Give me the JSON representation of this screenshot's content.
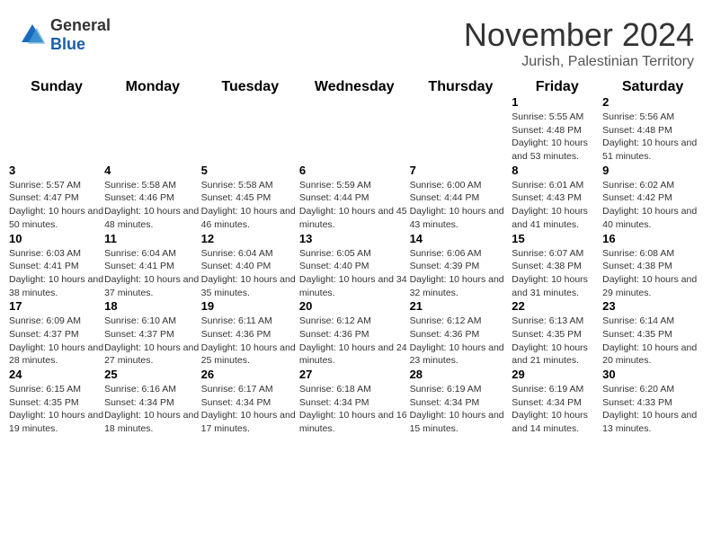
{
  "header": {
    "logo_general": "General",
    "logo_blue": "Blue",
    "month_title": "November 2024",
    "location": "Jurish, Palestinian Territory"
  },
  "days_of_week": [
    "Sunday",
    "Monday",
    "Tuesday",
    "Wednesday",
    "Thursday",
    "Friday",
    "Saturday"
  ],
  "weeks": [
    [
      {
        "day": "",
        "info": ""
      },
      {
        "day": "",
        "info": ""
      },
      {
        "day": "",
        "info": ""
      },
      {
        "day": "",
        "info": ""
      },
      {
        "day": "",
        "info": ""
      },
      {
        "day": "1",
        "info": "Sunrise: 5:55 AM\nSunset: 4:48 PM\nDaylight: 10 hours and 53 minutes."
      },
      {
        "day": "2",
        "info": "Sunrise: 5:56 AM\nSunset: 4:48 PM\nDaylight: 10 hours and 51 minutes."
      }
    ],
    [
      {
        "day": "3",
        "info": "Sunrise: 5:57 AM\nSunset: 4:47 PM\nDaylight: 10 hours and 50 minutes."
      },
      {
        "day": "4",
        "info": "Sunrise: 5:58 AM\nSunset: 4:46 PM\nDaylight: 10 hours and 48 minutes."
      },
      {
        "day": "5",
        "info": "Sunrise: 5:58 AM\nSunset: 4:45 PM\nDaylight: 10 hours and 46 minutes."
      },
      {
        "day": "6",
        "info": "Sunrise: 5:59 AM\nSunset: 4:44 PM\nDaylight: 10 hours and 45 minutes."
      },
      {
        "day": "7",
        "info": "Sunrise: 6:00 AM\nSunset: 4:44 PM\nDaylight: 10 hours and 43 minutes."
      },
      {
        "day": "8",
        "info": "Sunrise: 6:01 AM\nSunset: 4:43 PM\nDaylight: 10 hours and 41 minutes."
      },
      {
        "day": "9",
        "info": "Sunrise: 6:02 AM\nSunset: 4:42 PM\nDaylight: 10 hours and 40 minutes."
      }
    ],
    [
      {
        "day": "10",
        "info": "Sunrise: 6:03 AM\nSunset: 4:41 PM\nDaylight: 10 hours and 38 minutes."
      },
      {
        "day": "11",
        "info": "Sunrise: 6:04 AM\nSunset: 4:41 PM\nDaylight: 10 hours and 37 minutes."
      },
      {
        "day": "12",
        "info": "Sunrise: 6:04 AM\nSunset: 4:40 PM\nDaylight: 10 hours and 35 minutes."
      },
      {
        "day": "13",
        "info": "Sunrise: 6:05 AM\nSunset: 4:40 PM\nDaylight: 10 hours and 34 minutes."
      },
      {
        "day": "14",
        "info": "Sunrise: 6:06 AM\nSunset: 4:39 PM\nDaylight: 10 hours and 32 minutes."
      },
      {
        "day": "15",
        "info": "Sunrise: 6:07 AM\nSunset: 4:38 PM\nDaylight: 10 hours and 31 minutes."
      },
      {
        "day": "16",
        "info": "Sunrise: 6:08 AM\nSunset: 4:38 PM\nDaylight: 10 hours and 29 minutes."
      }
    ],
    [
      {
        "day": "17",
        "info": "Sunrise: 6:09 AM\nSunset: 4:37 PM\nDaylight: 10 hours and 28 minutes."
      },
      {
        "day": "18",
        "info": "Sunrise: 6:10 AM\nSunset: 4:37 PM\nDaylight: 10 hours and 27 minutes."
      },
      {
        "day": "19",
        "info": "Sunrise: 6:11 AM\nSunset: 4:36 PM\nDaylight: 10 hours and 25 minutes."
      },
      {
        "day": "20",
        "info": "Sunrise: 6:12 AM\nSunset: 4:36 PM\nDaylight: 10 hours and 24 minutes."
      },
      {
        "day": "21",
        "info": "Sunrise: 6:12 AM\nSunset: 4:36 PM\nDaylight: 10 hours and 23 minutes."
      },
      {
        "day": "22",
        "info": "Sunrise: 6:13 AM\nSunset: 4:35 PM\nDaylight: 10 hours and 21 minutes."
      },
      {
        "day": "23",
        "info": "Sunrise: 6:14 AM\nSunset: 4:35 PM\nDaylight: 10 hours and 20 minutes."
      }
    ],
    [
      {
        "day": "24",
        "info": "Sunrise: 6:15 AM\nSunset: 4:35 PM\nDaylight: 10 hours and 19 minutes."
      },
      {
        "day": "25",
        "info": "Sunrise: 6:16 AM\nSunset: 4:34 PM\nDaylight: 10 hours and 18 minutes."
      },
      {
        "day": "26",
        "info": "Sunrise: 6:17 AM\nSunset: 4:34 PM\nDaylight: 10 hours and 17 minutes."
      },
      {
        "day": "27",
        "info": "Sunrise: 6:18 AM\nSunset: 4:34 PM\nDaylight: 10 hours and 16 minutes."
      },
      {
        "day": "28",
        "info": "Sunrise: 6:19 AM\nSunset: 4:34 PM\nDaylight: 10 hours and 15 minutes."
      },
      {
        "day": "29",
        "info": "Sunrise: 6:19 AM\nSunset: 4:34 PM\nDaylight: 10 hours and 14 minutes."
      },
      {
        "day": "30",
        "info": "Sunrise: 6:20 AM\nSunset: 4:33 PM\nDaylight: 10 hours and 13 minutes."
      }
    ]
  ]
}
